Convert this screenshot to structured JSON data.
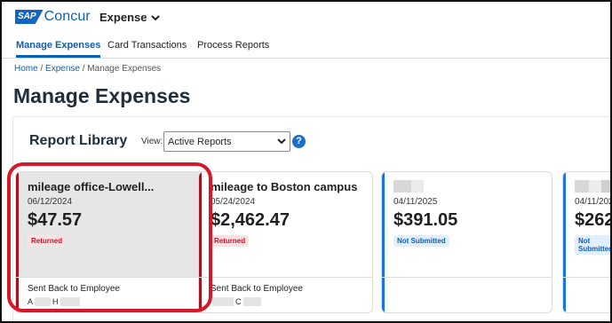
{
  "header": {
    "logo_sap": "SAP",
    "logo_concur": "Concur",
    "app_switcher_label": "Expense"
  },
  "nav": {
    "tabs": [
      {
        "label": "Manage Expenses",
        "active": true
      },
      {
        "label": "Card Transactions",
        "active": false
      },
      {
        "label": "Process Reports",
        "active": false
      }
    ]
  },
  "breadcrumb": {
    "home": "Home",
    "sep1": " / ",
    "expense": "Expense",
    "sep2": " / ",
    "current": "Manage Expenses"
  },
  "page": {
    "title": "Manage Expenses"
  },
  "library": {
    "title": "Report Library",
    "view_label": "View:",
    "view_value": "Active Reports",
    "help_glyph": "?"
  },
  "cards": [
    {
      "name": "mileage office-Lowell...",
      "date": "06/12/2024",
      "amount": "$47.57",
      "status": "Returned",
      "footer_label": "Sent Back to Employee",
      "footer_initials": [
        "A",
        "H"
      ]
    },
    {
      "name": "mileage to Boston campus",
      "date": "05/24/2024",
      "amount": "$2,462.47",
      "status": "Returned",
      "footer_label": "Sent Back to Employee",
      "footer_initials": [
        "C"
      ]
    },
    {
      "name": "",
      "date": "04/11/2025",
      "amount": "$391.05",
      "status": "Not Submitted"
    },
    {
      "name": "",
      "date": "04/11/2025",
      "amount": "$262",
      "status": "Not Submitted"
    }
  ],
  "colors": {
    "brand_blue": "#0a5fb4",
    "returned_stripe": "#a3151e",
    "not_submitted_stripe": "#1a73e8",
    "highlight_red": "#d7182a"
  }
}
